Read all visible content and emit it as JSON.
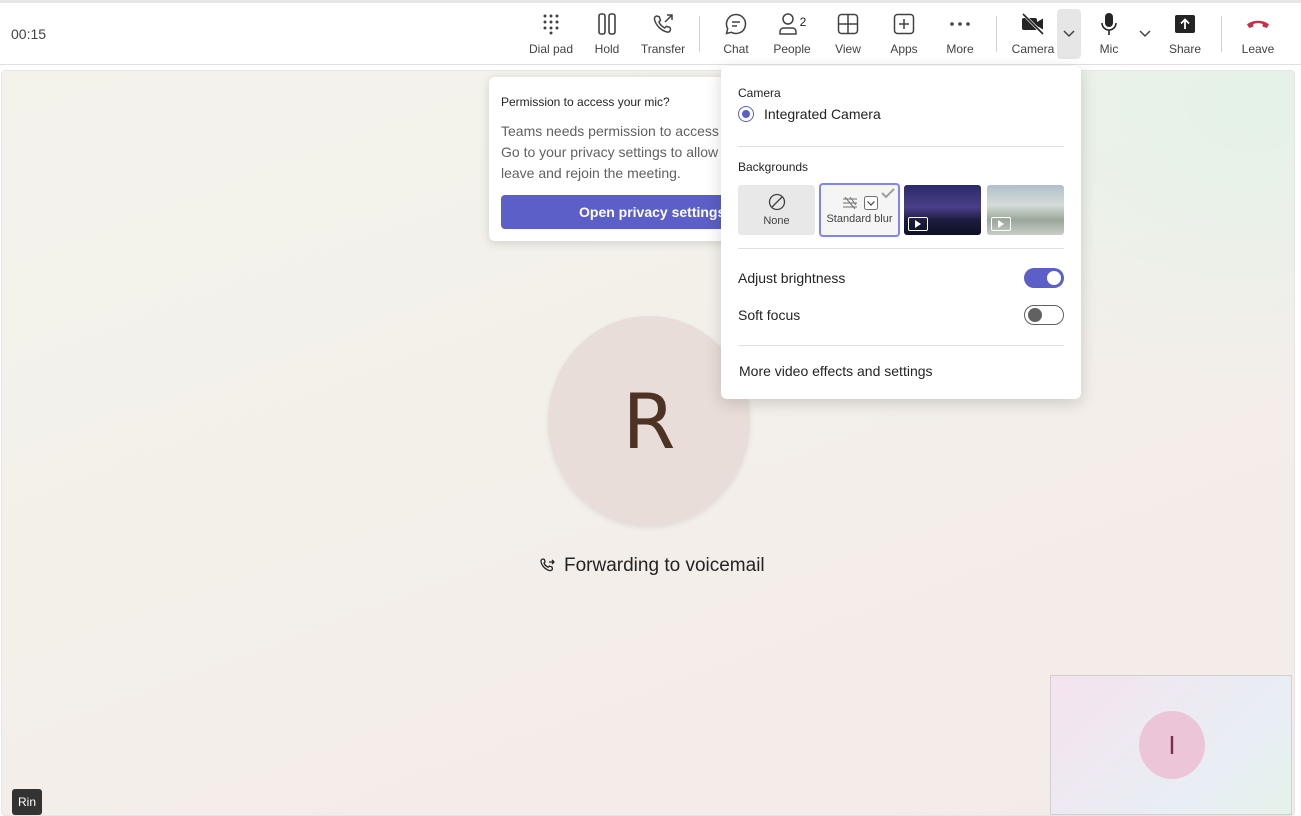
{
  "toolbar": {
    "timer": "00:15",
    "dialpad_label": "Dial pad",
    "hold_label": "Hold",
    "transfer_label": "Transfer",
    "chat_label": "Chat",
    "people_label": "People",
    "people_count": "2",
    "view_label": "View",
    "apps_label": "Apps",
    "more_label": "More",
    "camera_label": "Camera",
    "mic_label": "Mic",
    "share_label": "Share",
    "leave_label": "Leave"
  },
  "permission": {
    "title": "Permission to access your mic?",
    "body_lines": [
      "Teams needs permission to access your",
      "Go to your privacy settings to allow",
      "leave and rejoin the meeting."
    ],
    "button_label": "Open privacy settings"
  },
  "camera_menu": {
    "camera_heading": "Camera",
    "selected_camera": "Integrated Camera",
    "backgrounds_heading": "Backgrounds",
    "background_none": "None",
    "background_blur": "Standard blur",
    "adjust_brightness_label": "Adjust brightness",
    "adjust_brightness_on": true,
    "soft_focus_label": "Soft focus",
    "soft_focus_on": false,
    "more_link": "More video effects and settings"
  },
  "call": {
    "caller_initial": "R",
    "status": "Forwarding to voicemail",
    "name_tag": "Rin",
    "self_initial": "I"
  },
  "colors": {
    "accent": "#5b5fc7",
    "leave_red": "#c4314b"
  }
}
